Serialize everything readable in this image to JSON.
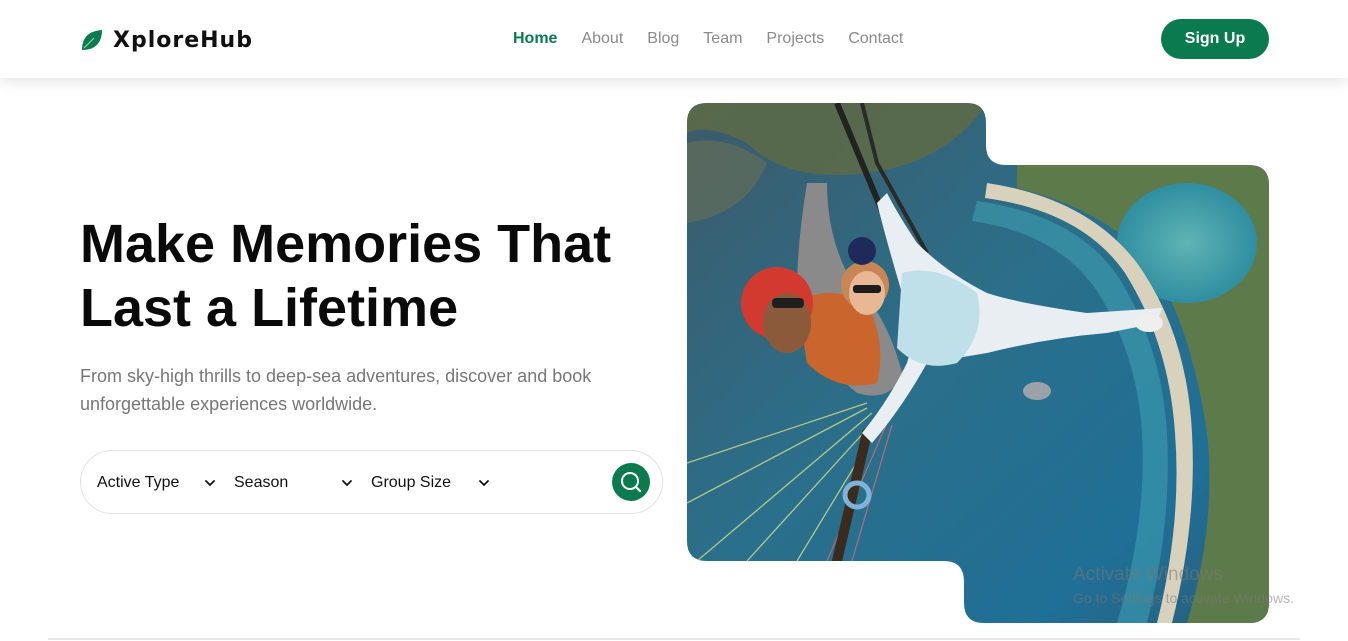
{
  "brand": {
    "name": "XploreHub",
    "accent": "#0b7a4f"
  },
  "nav": {
    "items": [
      "Home",
      "About",
      "Blog",
      "Team",
      "Projects",
      "Contact"
    ],
    "active": "Home"
  },
  "signup_label": "Sign Up",
  "hero": {
    "title_line1": "Make Memories That",
    "title_line2": "Last a Lifetime",
    "subtitle_line1": "From sky-high thrills to deep-sea adventures, discover and book",
    "subtitle_line2": "unforgettable experiences worldwide."
  },
  "search": {
    "filters": [
      "Active Type",
      "Season",
      "Group Size"
    ],
    "button_icon": "search-icon"
  },
  "hero_image": {
    "subject": "paragliding-tandem-over-coastline"
  },
  "watermark": {
    "line1": "Activate Windows",
    "line2": "Go to Settings to activate Windows."
  }
}
